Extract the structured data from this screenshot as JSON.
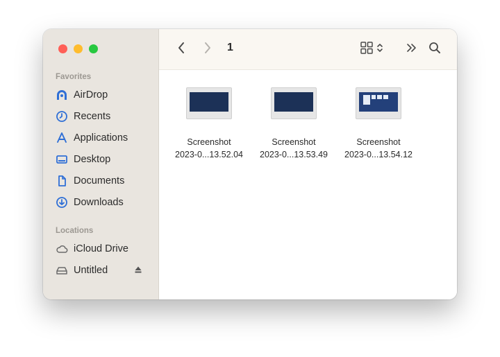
{
  "sidebar": {
    "favorites_title": "Favorites",
    "favorites": [
      {
        "label": "AirDrop",
        "icon": "airdrop-icon"
      },
      {
        "label": "Recents",
        "icon": "clock-icon"
      },
      {
        "label": "Applications",
        "icon": "applications-icon"
      },
      {
        "label": "Desktop",
        "icon": "desktop-icon"
      },
      {
        "label": "Documents",
        "icon": "document-icon"
      },
      {
        "label": "Downloads",
        "icon": "download-icon"
      }
    ],
    "locations_title": "Locations",
    "locations": [
      {
        "label": "iCloud Drive",
        "icon": "cloud-icon"
      },
      {
        "label": "Untitled",
        "icon": "drive-icon"
      }
    ]
  },
  "toolbar": {
    "title": "1"
  },
  "files": [
    {
      "name_line1": "Screenshot",
      "name_line2": "2023-0...13.52.04"
    },
    {
      "name_line1": "Screenshot",
      "name_line2": "2023-0...13.53.49"
    },
    {
      "name_line1": "Screenshot",
      "name_line2": "2023-0...13.54.12"
    }
  ],
  "colors": {
    "accent": "#2f6fd6",
    "sidebar_bg": "#e9e5df",
    "close": "#ff5f57",
    "minimize": "#febc2e",
    "zoom": "#28c840"
  }
}
